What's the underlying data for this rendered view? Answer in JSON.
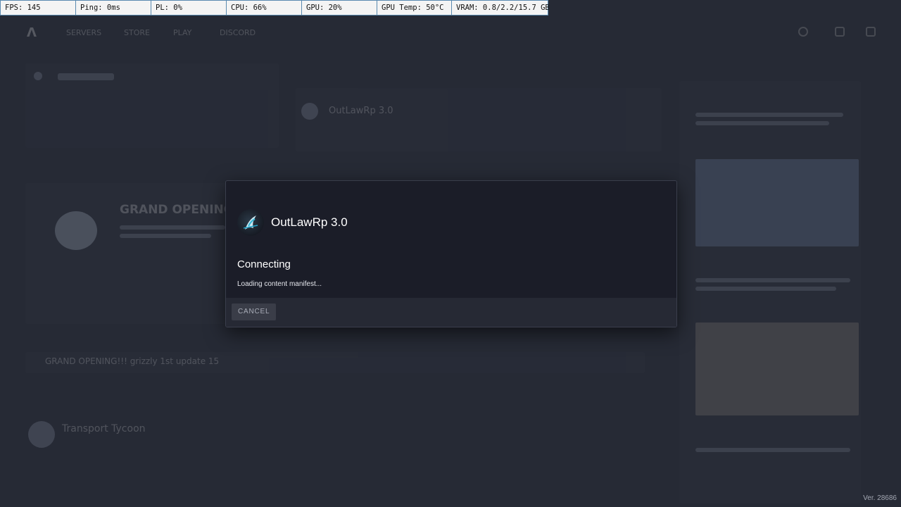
{
  "perf": [
    {
      "label": "FPS: 145",
      "width": 107
    },
    {
      "label": "Ping: 0ms",
      "width": 107
    },
    {
      "label": "PL: 0%",
      "width": 107
    },
    {
      "label": "CPU: 66%",
      "width": 107
    },
    {
      "label": "GPU: 20%",
      "width": 107
    },
    {
      "label": "GPU Temp: 50°C",
      "width": 106
    },
    {
      "label": "VRAM: 0.8/2.2/15.7 GB",
      "width": 136
    }
  ],
  "background": {
    "nav_links": [
      "SERVERS",
      "STORE",
      "PLAY",
      "DISCORD"
    ],
    "server_title_blurred": "OutLawRp 3.0",
    "promo_title": "GRAND OPENING",
    "news_bar": "GRAND OPENING!!! grizzly 1st update 15",
    "recent_title": "Transport Tycoon"
  },
  "modal": {
    "server_name": "OutLawRp 3.0",
    "status_title": "Connecting",
    "status_detail": "Loading content manifest...",
    "cancel_label": "CANCEL"
  },
  "version": "Ver. 28686"
}
